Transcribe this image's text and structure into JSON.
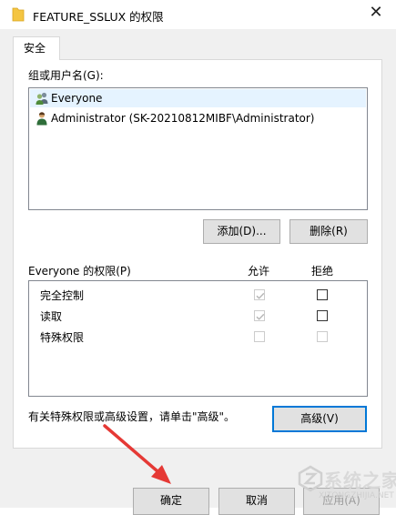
{
  "window": {
    "title": "FEATURE_SSLUX 的权限",
    "close_glyph": "✕",
    "icon": "folder-icon"
  },
  "tabs": [
    {
      "label": "安全",
      "active": true
    }
  ],
  "groups": {
    "label": "组或用户名(G):",
    "items": [
      {
        "label": "Everyone",
        "icon": "users-group-icon",
        "selected": true
      },
      {
        "label": "Administrator (SK-20210812MIBF\\Administrator)",
        "icon": "user-icon",
        "selected": false
      }
    ],
    "add_button": "添加(D)...",
    "remove_button": "删除(R)"
  },
  "permissions": {
    "label": "Everyone 的权限(P)",
    "allow_header": "允许",
    "deny_header": "拒绝",
    "rows": [
      {
        "name": "完全控制",
        "allow": true,
        "deny": false
      },
      {
        "name": "读取",
        "allow": true,
        "deny": false
      },
      {
        "name": "特殊权限",
        "allow": false,
        "deny": false
      }
    ]
  },
  "advanced": {
    "hint": "有关特殊权限或高级设置，请单击\"高级\"。",
    "button": "高级(V)"
  },
  "footer": {
    "ok": "确定",
    "cancel": "取消",
    "apply": "应用(A)"
  },
  "watermark": {
    "title": "系统之家",
    "url": "XITONGZHIJIA.NET"
  },
  "colors": {
    "accent": "#0078d7",
    "selection": "#e5f3ff",
    "arrow": "#e53935",
    "dialog_bg": "#f0f0f0"
  }
}
